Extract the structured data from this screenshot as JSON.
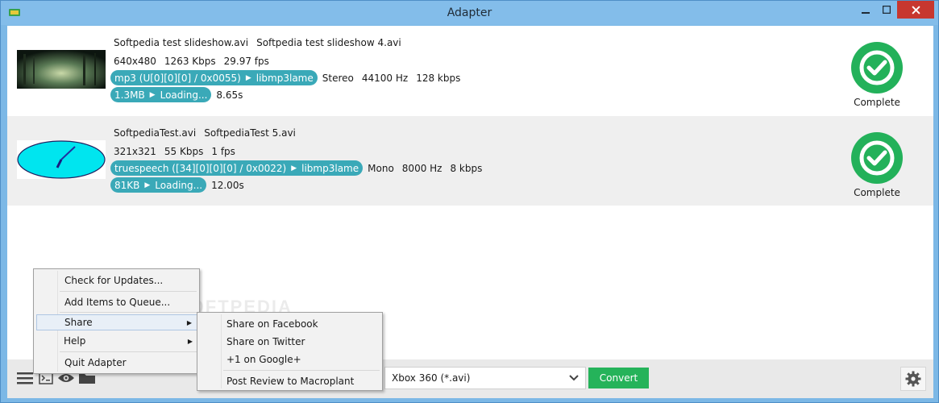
{
  "window": {
    "title": "Adapter"
  },
  "queue": [
    {
      "files": [
        "Softpedia test slideshow.avi",
        "Softpedia test slideshow 4.avi"
      ],
      "video": [
        "640x480",
        "1263 Kbps",
        "29.97 fps"
      ],
      "audio_codec": "mp3 (U[0][0][0] / 0x0055)",
      "audio_target": "libmp3lame",
      "audio_info": [
        "Stereo",
        "44100 Hz",
        "128 kbps"
      ],
      "size": "1.3MB",
      "progress_state": "Loading...",
      "duration": "8.65s",
      "status": "Complete"
    },
    {
      "files": [
        "SoftpediaTest.avi",
        "SoftpediaTest 5.avi"
      ],
      "video": [
        "321x321",
        "55 Kbps",
        "1 fps"
      ],
      "audio_codec": "truespeech ([34][0][0][0] / 0x0022)",
      "audio_target": "libmp3lame",
      "audio_info": [
        "Mono",
        "8000 Hz",
        "8 kbps"
      ],
      "size": "81KB",
      "progress_state": "Loading...",
      "duration": "12.00s",
      "status": "Complete"
    }
  ],
  "watermark": "SOFTPEDIA",
  "main_menu": {
    "items": [
      "Check for Updates...",
      "Add Items to Queue...",
      "Share",
      "Help",
      "Quit Adapter"
    ]
  },
  "share_menu": {
    "items": [
      "Share on Facebook",
      "Share on Twitter",
      "+1 on Google+",
      "Post Review to Macroplant"
    ]
  },
  "toolbar": {
    "preset_value": "Xbox 360 (*.avi)",
    "convert_label": "Convert"
  },
  "colors": {
    "accent": "#25b35a",
    "pill": "#3aa9b8",
    "titlebar": "#83bdea",
    "close": "#c7372f"
  },
  "icons": [
    "hamburger-icon",
    "console-icon",
    "eye-icon",
    "folder-icon",
    "gear-icon",
    "checkmark-icon"
  ]
}
